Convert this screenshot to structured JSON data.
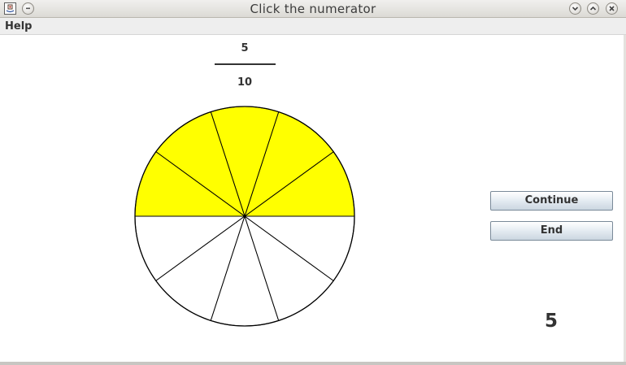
{
  "window": {
    "title": "Click the numerator"
  },
  "menu": {
    "items": [
      {
        "label": "Help"
      }
    ]
  },
  "fraction": {
    "numerator": "5",
    "denominator": "10"
  },
  "pie": {
    "total_slices": 10,
    "shaded_slices": 5,
    "shaded_color": "#ffff00",
    "unshaded_color": "#ffffff",
    "outline_color": "#000000"
  },
  "buttons": {
    "continue_label": "Continue",
    "end_label": "End"
  },
  "score": {
    "value": "5"
  },
  "icons": {
    "app": "java-app-icon",
    "menu": "window-menu-icon",
    "minimize": "chevron-down-icon",
    "maximize": "chevron-up-icon",
    "close": "close-icon"
  }
}
